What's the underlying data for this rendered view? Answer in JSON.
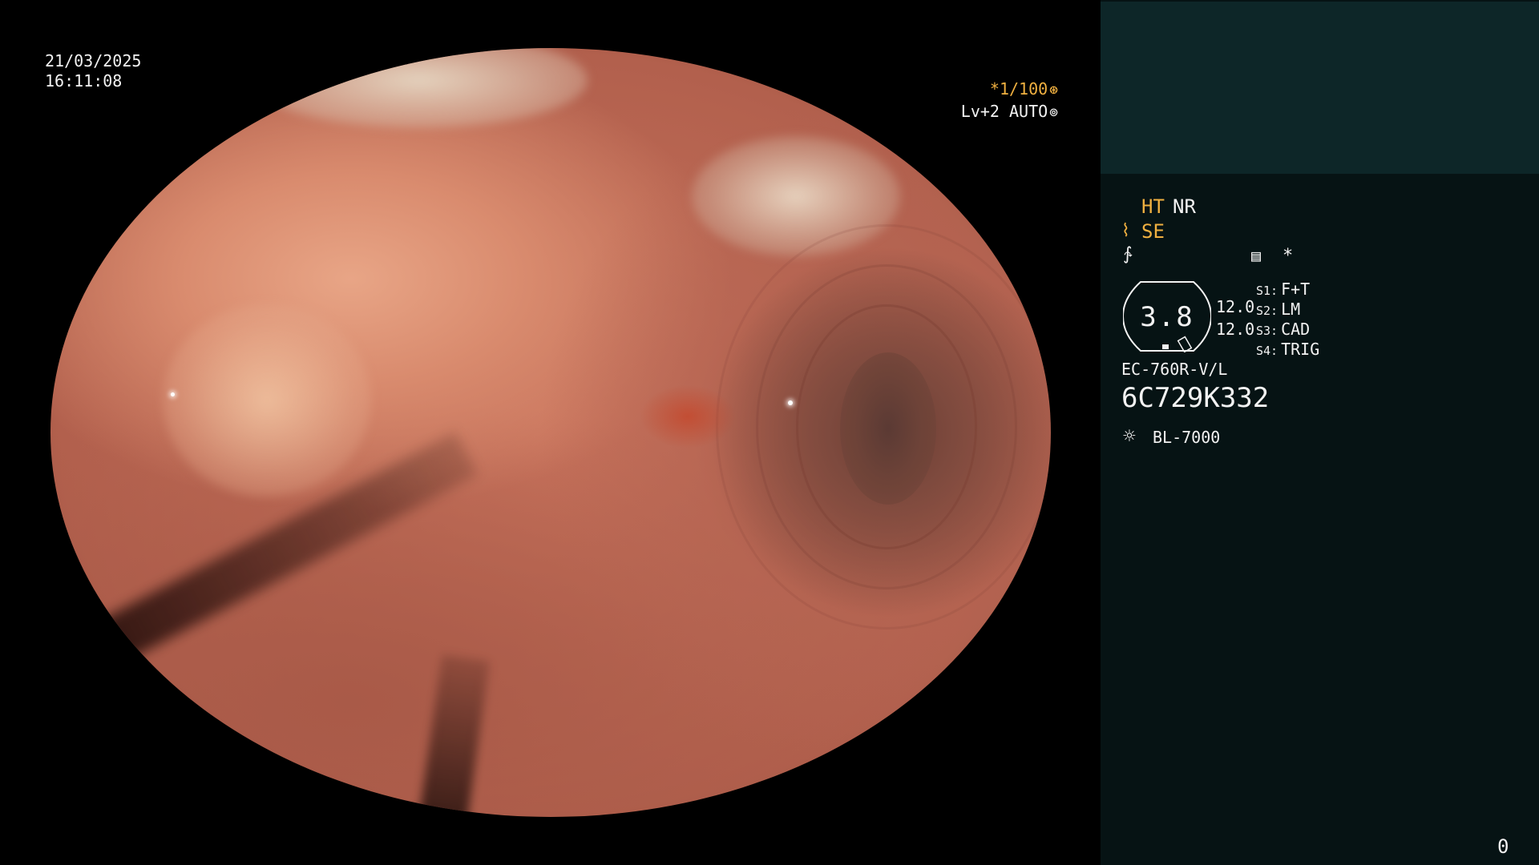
{
  "overlay": {
    "date": "21/03/2025",
    "time": "16:11:08",
    "shutter": "*1/100",
    "iris": "Lv+2 AUTO"
  },
  "icons": {
    "shutter": "aperture-icon",
    "iris": "iris-icon",
    "se": "curve-icon",
    "f": "slash-icon",
    "memo": "memo-icon",
    "light": "sun-icon"
  },
  "panel": {
    "mode_ht": "HT",
    "mode_nr": "NR",
    "mode_se": "SE",
    "star": "*",
    "dial_value": "3.8",
    "value_1": "12.0",
    "value_2": "12.0",
    "slots": [
      {
        "key": "S1:",
        "value": "F+T"
      },
      {
        "key": "S2:",
        "value": "LM"
      },
      {
        "key": "S3:",
        "value": "CAD"
      },
      {
        "key": "S4:",
        "value": "TRIG"
      }
    ],
    "model": "EC-760R-V/L",
    "serial": "6C729K332",
    "light_source": "BL-7000",
    "counter": "0"
  },
  "colors": {
    "accent": "#f0b040",
    "panel_bg": "#061314",
    "panel_top_bg": "#0d2628",
    "text": "#f2f2f2"
  }
}
